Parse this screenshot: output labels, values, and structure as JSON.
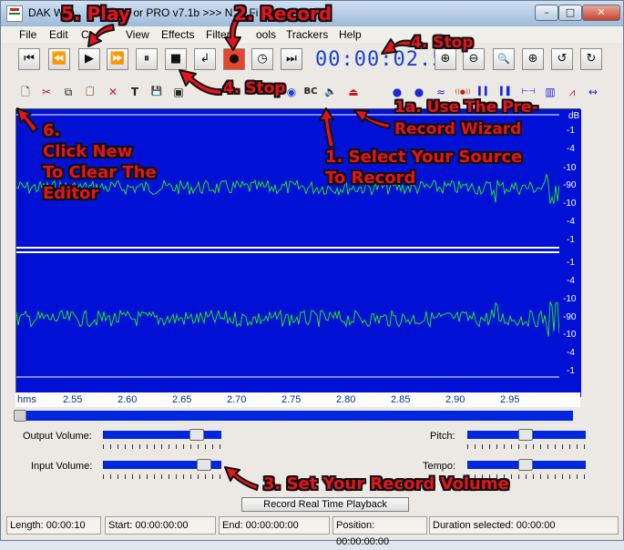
{
  "window": {
    "title": "DAK Wave & Audio Editor PRO v7.1b >>> New File",
    "title_visible_start": "DAK W",
    "title_visible_mid": "or PRO v7.1b >>> N",
    "title_visible_end": "w Fi",
    "minimize": "–",
    "maximize": "□",
    "close": "✕"
  },
  "menu": [
    {
      "label": "File"
    },
    {
      "label": "Edit"
    },
    {
      "label": "Controls"
    },
    {
      "label": "View"
    },
    {
      "label": "Effects"
    },
    {
      "label": "Filters"
    },
    {
      "label": "Tools"
    },
    {
      "label": "Trackers"
    },
    {
      "label": "Help"
    }
  ],
  "menu_visible": {
    "file": "File",
    "edit": "Edit",
    "c": "C",
    "view": "View",
    "effects": "Effects",
    "filter": "Filters",
    "tools": "ools",
    "trackers": "Trackers",
    "help": "Help"
  },
  "transport": {
    "buttons": [
      {
        "icon": "skip-to-start-icon",
        "glyph": "⏮"
      },
      {
        "icon": "rewind-icon",
        "glyph": "⏪"
      },
      {
        "icon": "play-icon",
        "glyph": "▶"
      },
      {
        "icon": "fast-forward-icon",
        "glyph": "⏩"
      },
      {
        "icon": "pause-icon",
        "glyph": "⏸"
      },
      {
        "icon": "stop-icon",
        "glyph": "■"
      },
      {
        "icon": "return-icon",
        "glyph": "↲"
      },
      {
        "icon": "record-icon",
        "glyph": "●"
      },
      {
        "icon": "timer-icon",
        "glyph": "◷"
      },
      {
        "icon": "skip-to-end-icon",
        "glyph": "⏭"
      }
    ],
    "time": "00:00:02.5",
    "view_buttons": [
      {
        "icon": "zoom-in-icon",
        "glyph": "⊕"
      },
      {
        "icon": "zoom-out-icon",
        "glyph": "⊖"
      },
      {
        "icon": "zoom-icon",
        "glyph": "🔍"
      },
      {
        "icon": "zoom-full-icon",
        "glyph": "⊕"
      },
      {
        "icon": "undo-icon",
        "glyph": "↺"
      },
      {
        "icon": "redo-icon",
        "glyph": "↻"
      }
    ]
  },
  "edit_toolbar": [
    {
      "icon": "new-file-icon",
      "glyph": "🗋"
    },
    {
      "icon": "cut-icon",
      "glyph": "✂"
    },
    {
      "icon": "copy-icon",
      "glyph": "⧉"
    },
    {
      "icon": "paste-icon",
      "glyph": "📋"
    },
    {
      "icon": "delete-icon",
      "glyph": "✕"
    },
    {
      "icon": "text-icon",
      "glyph": "T"
    },
    {
      "icon": "save-icon",
      "glyph": "💾"
    },
    {
      "icon": "save-all-icon",
      "glyph": "▣"
    },
    {
      "icon": "volume-icon",
      "glyph": "◉"
    },
    {
      "icon": "bc-icon",
      "glyph": "BC"
    },
    {
      "icon": "record-source-icon",
      "glyph": "🔈"
    },
    {
      "icon": "pre-record-wizard-icon",
      "glyph": "⏏"
    },
    {
      "icon": "blue-dot-1-icon",
      "glyph": "●"
    },
    {
      "icon": "blue-dot-2-icon",
      "glyph": "●"
    },
    {
      "icon": "wave-icon",
      "glyph": "≈"
    },
    {
      "icon": "echo-icon",
      "glyph": "((●))"
    },
    {
      "icon": "bars-icon",
      "glyph": "▍▍"
    },
    {
      "icon": "bars2-icon",
      "glyph": "▍▌"
    },
    {
      "icon": "marker-icon",
      "glyph": "⊢⊣"
    },
    {
      "icon": "spectrum-icon",
      "glyph": "▥"
    },
    {
      "icon": "waveform-icon",
      "glyph": "⩘"
    },
    {
      "icon": "graph-icon",
      "glyph": "▟"
    },
    {
      "icon": "stretch-icon",
      "glyph": "↔"
    }
  ],
  "scale_labels": [
    "dB",
    "-1",
    "-4",
    "-10",
    "-90",
    "-10",
    "-4",
    "-1",
    "-1",
    "-4",
    "-10",
    "-90",
    "-10",
    "-4",
    "-1"
  ],
  "time_axis": {
    "unit": "hms",
    "ticks": [
      "2.55",
      "2.60",
      "2.65",
      "2.70",
      "2.75",
      "2.80",
      "2.85",
      "2.90",
      "2.95"
    ]
  },
  "controls": {
    "output_volume": {
      "label": "Output Volume:",
      "level": 0.83
    },
    "input_volume": {
      "label": "Input Volume:",
      "level": 0.9
    },
    "pitch": {
      "label": "Pitch:",
      "level": 0.49
    },
    "tempo": {
      "label": "Tempo:",
      "level": 0.49
    },
    "record_button": "Record Real Time Playback"
  },
  "status": {
    "length": "Length: 00:00:10",
    "start": "Start: 00:00:00:00",
    "end": "End: 00:00:00:00",
    "position": "Position: 00:00:00:00",
    "duration": "Duration selected: 00:00:00"
  },
  "annotations": {
    "play": "5. Play",
    "record": "2. Record",
    "stop_top": "4. Stop",
    "stop_mid": "4. Stop",
    "wizard_l1": "1a. Use The Pre-",
    "wizard_l2": "Record Wizard",
    "new_l1": "6.",
    "new_l2": "Click New",
    "new_l3": "To Clear The",
    "new_l4": "Editor",
    "source_l1": "1. Select Your Source",
    "source_l2": "To Record",
    "volume": "3. Set Your Record Volume"
  },
  "colors": {
    "waveform": "#22e02a",
    "editor_bg": "#0010d4",
    "annotation": "#e3141c"
  }
}
